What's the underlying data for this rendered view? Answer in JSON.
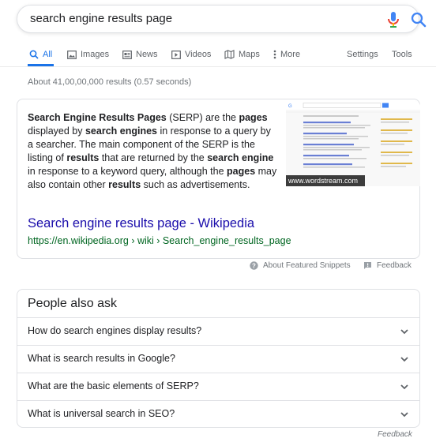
{
  "search": {
    "query": "search engine results page"
  },
  "tabs": [
    {
      "label": "All",
      "icon": "search-icon",
      "active": true
    },
    {
      "label": "Images",
      "icon": "image-icon"
    },
    {
      "label": "News",
      "icon": "news-icon"
    },
    {
      "label": "Videos",
      "icon": "video-icon"
    },
    {
      "label": "Maps",
      "icon": "map-icon"
    },
    {
      "label": "More",
      "icon": "more-vert-icon"
    },
    {
      "label": "Settings"
    },
    {
      "label": "Tools"
    }
  ],
  "result_stats": "About 41,00,00,000 results (0.57 seconds)",
  "featured_snippet": {
    "segments": [
      {
        "t": "Search Engine Results Pages",
        "b": true
      },
      {
        "t": " (SERP) are the ",
        "b": false
      },
      {
        "t": "pages",
        "b": true
      },
      {
        "t": " displayed by ",
        "b": false
      },
      {
        "t": "search engines",
        "b": true
      },
      {
        "t": " in response to a query by a searcher. The main component of the SERP is the listing of ",
        "b": false
      },
      {
        "t": "results",
        "b": true
      },
      {
        "t": " that are returned by the ",
        "b": false
      },
      {
        "t": "search engine",
        "b": true
      },
      {
        "t": " in response to a keyword query, although the ",
        "b": false
      },
      {
        "t": "pages",
        "b": true
      },
      {
        "t": " may also contain other ",
        "b": false
      },
      {
        "t": "results",
        "b": true
      },
      {
        "t": " such as advertisements.",
        "b": false
      }
    ],
    "image_caption": "www.wordstream.com",
    "title": "Search engine results page - Wikipedia",
    "url": "https://en.wikipedia.org › wiki › Search_engine_results_page"
  },
  "snippet_footer": {
    "about_label": "About Featured Snippets",
    "feedback_label": "Feedback"
  },
  "people_also_ask": {
    "heading": "People also ask",
    "questions": [
      "How do search engines display results?",
      "What is search results in Google?",
      "What are the basic elements of SERP?",
      "What is universal search in SEO?"
    ]
  },
  "bottom_feedback": "Feedback",
  "colors": {
    "link": "#1a0dab",
    "url": "#006621",
    "accent": "#1a73e8",
    "muted": "#70757a"
  }
}
